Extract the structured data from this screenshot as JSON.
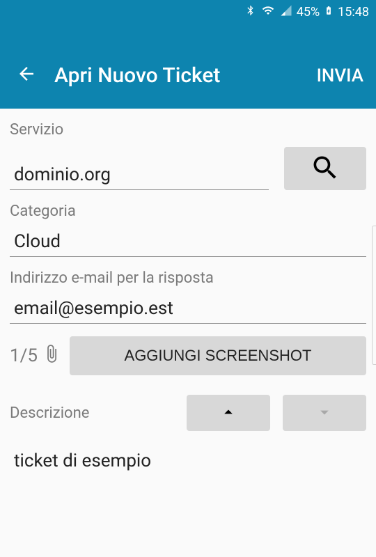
{
  "status": {
    "battery": "45%",
    "time": "15:48"
  },
  "header": {
    "title": "Apri Nuovo Ticket",
    "send": "INVIA"
  },
  "form": {
    "service_label": "Servizio",
    "service_value": "dominio.org",
    "category_label": "Categoria",
    "category_value": "Cloud",
    "email_label": "Indirizzo e-mail per la risposta",
    "email_value": "email@esempio.est",
    "attach_count": "1/5",
    "add_screenshot": "AGGIUNGI SCREENSHOT",
    "description_label": "Descrizione",
    "description_value": "ticket di esempio"
  }
}
